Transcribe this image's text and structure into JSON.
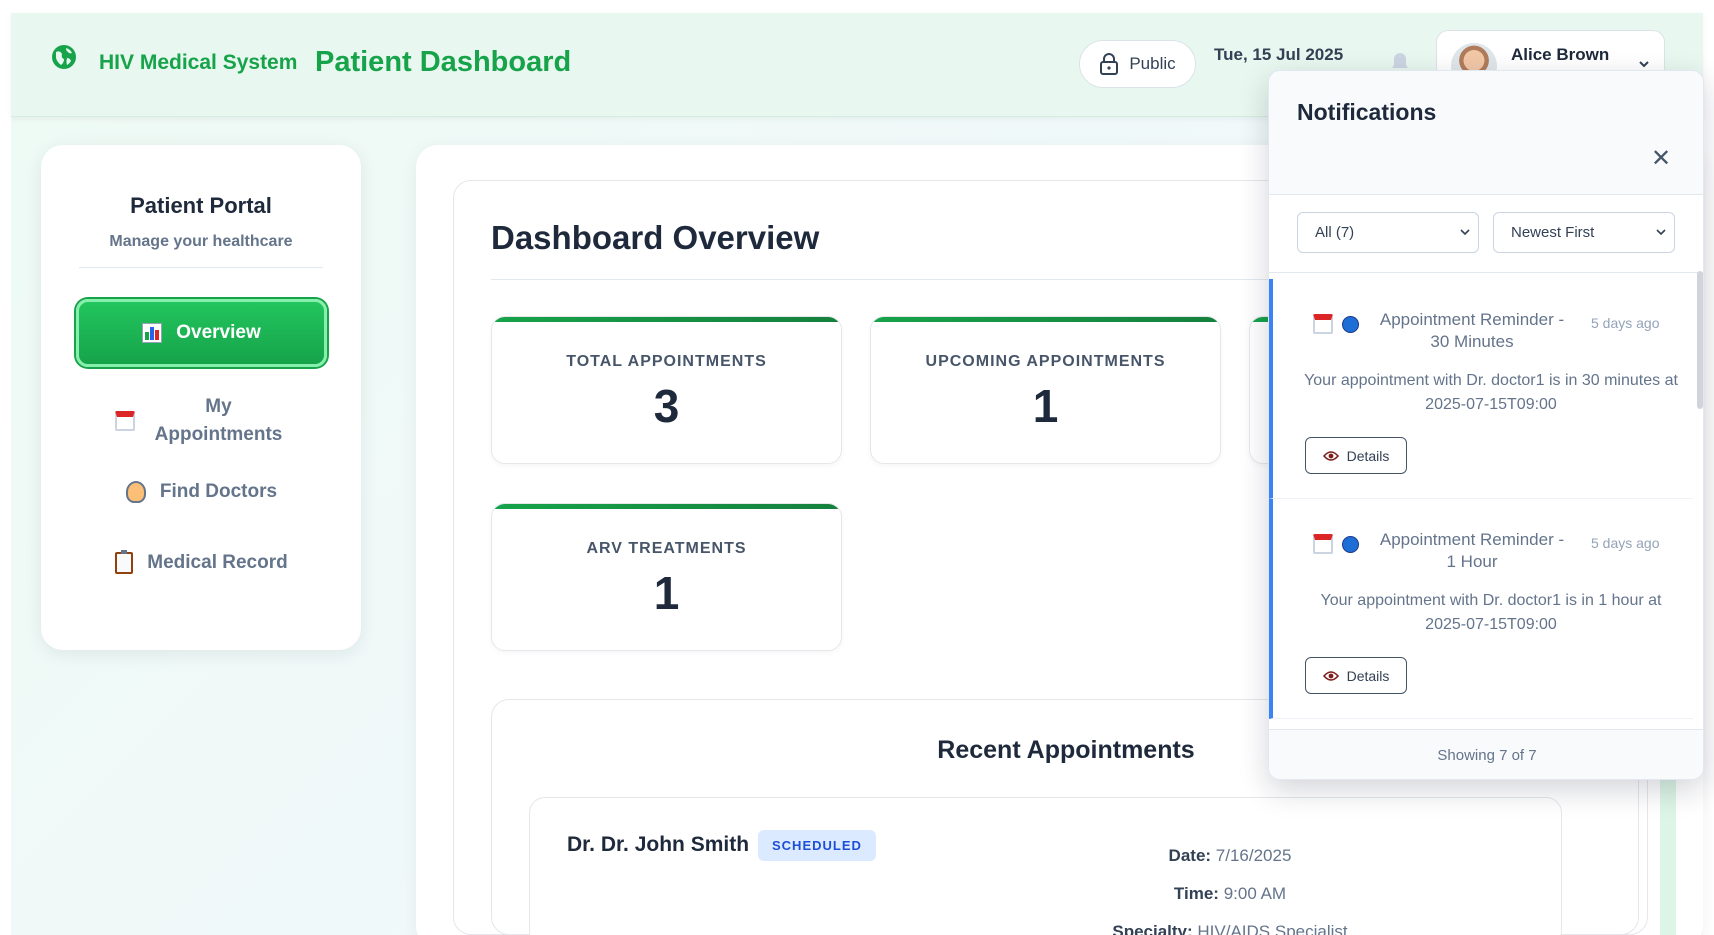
{
  "header": {
    "brand_name": "HIV Medical System",
    "page_title": "Patient Dashboard",
    "visibility_label": "Public",
    "date": "Tue, 15 Jul 2025",
    "user_name": "Alice Brown"
  },
  "sidebar": {
    "title": "Patient Portal",
    "subtitle": "Manage your healthcare",
    "items": [
      {
        "label": "Overview",
        "icon": "bar-chart-icon",
        "active": true
      },
      {
        "label": "My Appointments",
        "icon": "calendar-icon",
        "active": false
      },
      {
        "label": "Find Doctors",
        "icon": "doctor-icon",
        "active": false
      },
      {
        "label": "Medical Record",
        "icon": "clipboard-icon",
        "active": false
      }
    ]
  },
  "dashboard": {
    "title": "Dashboard Overview",
    "stats": [
      {
        "label": "TOTAL APPOINTMENTS",
        "value": "3"
      },
      {
        "label": "UPCOMING APPOINTMENTS",
        "value": "1"
      },
      {
        "label": "ARV TREATMENTS",
        "value": "1"
      }
    ],
    "recent": {
      "title": "Recent Appointments",
      "appointment": {
        "doctor": "Dr. Dr. John Smith",
        "status": "SCHEDULED",
        "date_label": "Date:",
        "date": "7/16/2025",
        "time_label": "Time:",
        "time": "9:00 AM",
        "specialty_label": "Specialty:",
        "specialty": "HIV/AIDS Specialist"
      }
    }
  },
  "notifications": {
    "title": "Notifications",
    "filter_selected": "All (7)",
    "sort_selected": "Newest First",
    "items": [
      {
        "title": "Appointment Reminder - 30 Minutes",
        "time": "5 days ago",
        "message": "Your appointment with Dr. doctor1 is in 30 minutes at 2025-07-15T09:00",
        "button": "Details"
      },
      {
        "title": "Appointment Reminder - 1 Hour",
        "time": "5 days ago",
        "message": "Your appointment with Dr. doctor1 is in 1 hour at 2025-07-15T09:00",
        "button": "Details"
      }
    ],
    "footer": "Showing 7 of 7"
  },
  "colors": {
    "brand": "#16a34a",
    "accent_blue": "#3b82f6",
    "badge_bg": "#dbeafe"
  }
}
